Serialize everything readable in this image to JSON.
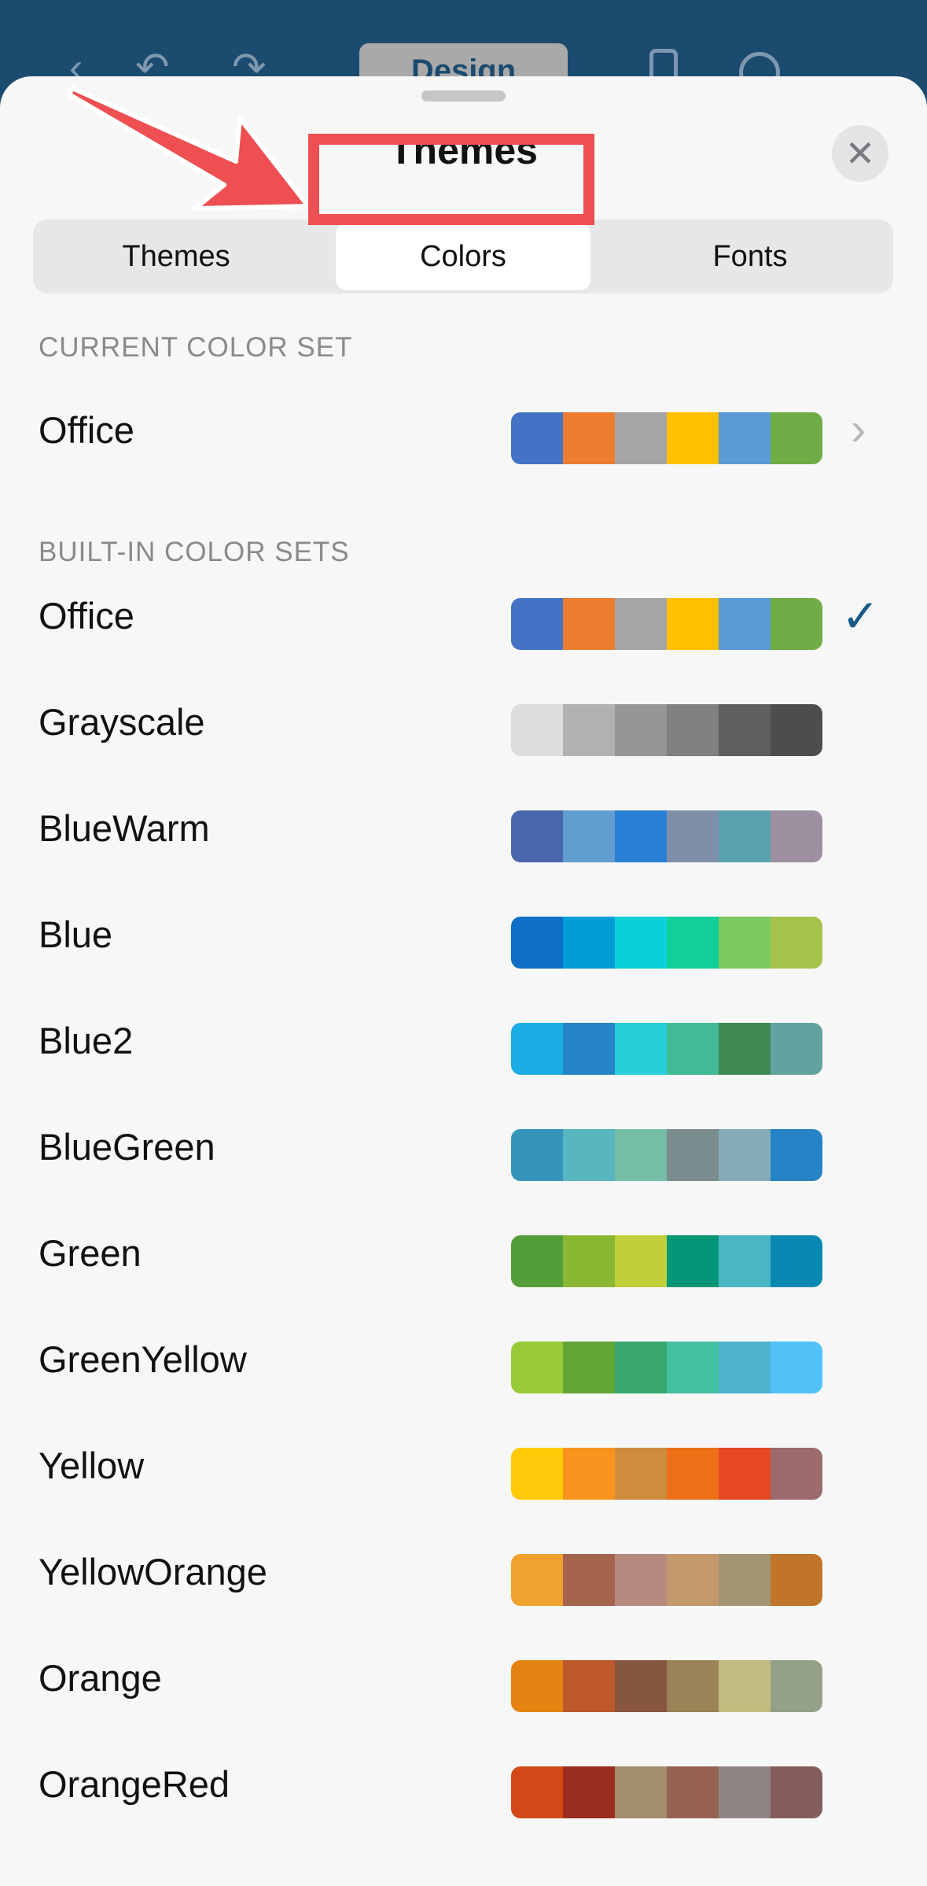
{
  "toolbar": {
    "design_label": "Design",
    "back_icon": "chevron-left",
    "undo_icon": "undo",
    "redo_icon": "redo",
    "more_icon": "ellipsis"
  },
  "sheet": {
    "title": "Themes",
    "close_icon": "close",
    "tabs": [
      {
        "label": "Themes",
        "selected": false
      },
      {
        "label": "Colors",
        "selected": true
      },
      {
        "label": "Fonts",
        "selected": false
      }
    ]
  },
  "current": {
    "section_label": "CURRENT COLOR SET",
    "name": "Office",
    "colors": [
      "#4472c4",
      "#ed7d31",
      "#a5a5a5",
      "#ffc000",
      "#5b9bd5",
      "#70ad47"
    ]
  },
  "builtin": {
    "section_label": "BUILT-IN COLOR SETS",
    "sets": [
      {
        "name": "Office",
        "checked": true,
        "colors": [
          "#4472c4",
          "#ed7d31",
          "#a5a5a5",
          "#ffc000",
          "#5b9bd5",
          "#70ad47"
        ]
      },
      {
        "name": "Grayscale",
        "checked": false,
        "colors": [
          "#dddddd",
          "#b2b2b2",
          "#969696",
          "#808080",
          "#5f5f5f",
          "#4d4d4d"
        ]
      },
      {
        "name": "BlueWarm",
        "checked": false,
        "colors": [
          "#4a66ac",
          "#629dd1",
          "#297fd5",
          "#7f8fa9",
          "#5aa2ae",
          "#9d90a0"
        ]
      },
      {
        "name": "Blue",
        "checked": false,
        "colors": [
          "#0f6fc6",
          "#009dd9",
          "#0bd0d9",
          "#10cf9b",
          "#7cca62",
          "#a5c249"
        ]
      },
      {
        "name": "Blue2",
        "checked": false,
        "colors": [
          "#1cade4",
          "#2683c6",
          "#27ced7",
          "#42ba97",
          "#3e8853",
          "#62a39f"
        ]
      },
      {
        "name": "BlueGreen",
        "checked": false,
        "colors": [
          "#3494ba",
          "#58b6c0",
          "#75bda7",
          "#7a8c8e",
          "#84acb6",
          "#2683c6"
        ]
      },
      {
        "name": "Green",
        "checked": false,
        "colors": [
          "#549e39",
          "#8ab833",
          "#c0cf3a",
          "#029676",
          "#4ab5c4",
          "#0989b1"
        ]
      },
      {
        "name": "GreenYellow",
        "checked": false,
        "colors": [
          "#99cb38",
          "#63a537",
          "#37a76f",
          "#44c1a3",
          "#4eb3cf",
          "#51c3f9"
        ]
      },
      {
        "name": "Yellow",
        "checked": false,
        "colors": [
          "#ffca08",
          "#f8931d",
          "#ce8d3e",
          "#ec7016",
          "#e64823",
          "#9c6a6a"
        ]
      },
      {
        "name": "YellowOrange",
        "checked": false,
        "colors": [
          "#f0a22e",
          "#a5644e",
          "#b58b80",
          "#c3986d",
          "#a19574",
          "#c17529"
        ]
      },
      {
        "name": "Orange",
        "checked": false,
        "colors": [
          "#e48312",
          "#bd582c",
          "#865640",
          "#9b8357",
          "#c2bc80",
          "#94a088"
        ]
      },
      {
        "name": "OrangeRed",
        "checked": false,
        "colors": [
          "#d34817",
          "#9b2d1f",
          "#a28e6a",
          "#956251",
          "#918485",
          "#855d5d"
        ]
      }
    ]
  }
}
